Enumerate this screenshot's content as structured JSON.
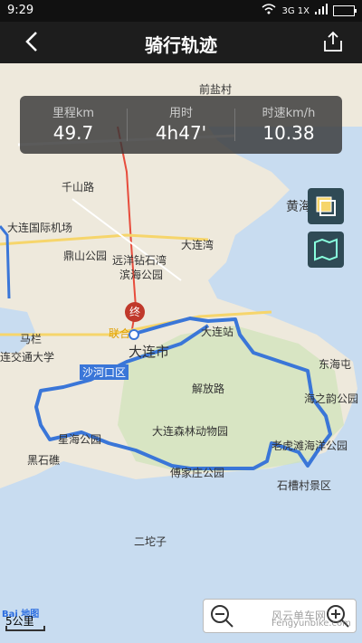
{
  "status_bar": {
    "time": "9:29",
    "net": "3G 1X"
  },
  "header": {
    "title": "骑行轨迹"
  },
  "stats": [
    {
      "label": "里程km",
      "value": "49.7"
    },
    {
      "label": "用时",
      "value": "4h47'"
    },
    {
      "label": "时速km/h",
      "value": "10.38"
    }
  ],
  "map": {
    "labels": [
      "前盐村",
      "千山路",
      "大连国际机场",
      "鼎山公园",
      "远洋钻石湾",
      "滨海公园",
      "大连湾",
      "黄海",
      "马栏",
      "连交通大学",
      "大连站",
      "大连市",
      "沙河口区",
      "解放路",
      "东海屯",
      "海之韵公园",
      "星海公园",
      "大连森林动物园",
      "老虎滩海洋公园",
      "黑石礁",
      "石槽村景区",
      "傅家庄公园",
      "二坨子",
      "联合"
    ],
    "end_marker": "终",
    "scale": "5公里",
    "map_logo": "Bai 地图",
    "watermark": "风云单车网",
    "watermark_url": "Fengyunbike.com"
  }
}
